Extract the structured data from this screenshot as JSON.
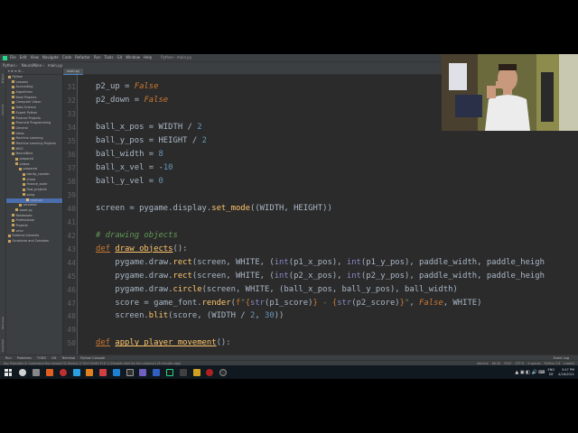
{
  "ide": {
    "window_title": "Python - main.py",
    "menu": [
      "File",
      "Edit",
      "View",
      "Navigate",
      "Code",
      "Refactor",
      "Run",
      "Tools",
      "Git",
      "Window",
      "Help"
    ],
    "nav": [
      "Python",
      "NeuralNine",
      "main.py"
    ],
    "tab": "main.py",
    "vertical_tabs": [
      "Project",
      "Commit",
      "Structure",
      "Favorites"
    ]
  },
  "project_tree": [
    {
      "label": "Python",
      "indent": 0
    },
    {
      "label": "Lessons",
      "indent": 1
    },
    {
      "label": "Accounting",
      "indent": 1
    },
    {
      "label": "Algorithms",
      "indent": 1
    },
    {
      "label": "Book Projects",
      "indent": 1
    },
    {
      "label": "Computer Vision",
      "indent": 1
    },
    {
      "label": "Data Science",
      "indent": 1
    },
    {
      "label": "Expert Python",
      "indent": 1
    },
    {
      "label": "Finance Projects",
      "indent": 1
    },
    {
      "label": "Financial Programming",
      "indent": 1
    },
    {
      "label": "General",
      "indent": 1
    },
    {
      "label": "Ideas",
      "indent": 1
    },
    {
      "label": "Machine Learning",
      "indent": 1
    },
    {
      "label": "Machine Learning Projects",
      "indent": 1
    },
    {
      "label": "MISC",
      "indent": 1
    },
    {
      "label": "NeuralNine",
      "indent": 1
    },
    {
      "label": "prepared",
      "indent": 2
    },
    {
      "label": "videos",
      "indent": 2
    },
    {
      "label": "prepared",
      "indent": 3
    },
    {
      "label": "bbcrip_counter",
      "indent": 4
    },
    {
      "label": "chess",
      "indent": 4
    },
    {
      "label": "finance_scale",
      "indent": 4
    },
    {
      "label": "flow_projects",
      "indent": 4
    },
    {
      "label": "pong",
      "indent": 4
    },
    {
      "label": "main.py",
      "indent": 5,
      "selected": true
    },
    {
      "label": "recorded",
      "indent": 3
    },
    {
      "label": "asset.py",
      "indent": 2
    },
    {
      "label": "Notebooks",
      "indent": 1
    },
    {
      "label": "Professional",
      "indent": 1
    },
    {
      "label": "Projects",
      "indent": 1
    },
    {
      "label": "venv",
      "indent": 1
    },
    {
      "label": "External Libraries",
      "indent": 0
    },
    {
      "label": "Scratches and Consoles",
      "indent": 0
    }
  ],
  "code_lines": [
    {
      "n": "31",
      "html": "p2_up = <span style=\"color:#cc7832;font-style:italic\">False</span>"
    },
    {
      "n": "32",
      "html": "p2_down = <span style=\"color:#cc7832;font-style:italic\">False</span>"
    },
    {
      "n": "33",
      "html": ""
    },
    {
      "n": "34",
      "html": "ball_x_pos = WIDTH / <span style=\"color:#6897bb\">2</span>"
    },
    {
      "n": "35",
      "html": "ball_y_pos = HEIGHT / <span style=\"color:#6897bb\">2</span>"
    },
    {
      "n": "36",
      "html": "ball_width = <span style=\"color:#6897bb\">8</span>"
    },
    {
      "n": "37",
      "html": "ball_x_vel = -<span style=\"color:#6897bb\">10</span>"
    },
    {
      "n": "38",
      "html": "ball_y_vel = <span style=\"color:#6897bb\">0</span>"
    },
    {
      "n": "39",
      "html": ""
    },
    {
      "n": "40",
      "html": "screen = pygame.display.<span style=\"color:#ffc66d\">set_mode</span>((WIDTH, HEIGHT))"
    },
    {
      "n": "41",
      "html": ""
    },
    {
      "n": "42",
      "html": "<span style=\"color:#629755;font-style:italic\"># drawing objects</span>"
    },
    {
      "n": "43",
      "html": "<span style=\"color:#cc7832;text-decoration:underline\">def</span> <span style=\"color:#ffc66d;text-decoration:underline\">draw_objects</span>():"
    },
    {
      "n": "44",
      "html": "    pygame.draw.<span style=\"color:#ffc66d\">rect</span>(screen, WHITE, (<span style=\"color:#8888c6\">int</span>(p1_x_pos), <span style=\"color:#8888c6\">int</span>(p1_y_pos), paddle_width, paddle_heigh"
    },
    {
      "n": "45",
      "html": "    pygame.draw.<span style=\"color:#ffc66d\">rect</span>(screen, WHITE, (<span style=\"color:#8888c6\">int</span>(p2_x_pos), <span style=\"color:#8888c6\">int</span>(p2_y_pos), paddle_width, paddle_heigh"
    },
    {
      "n": "46",
      "html": "    pygame.draw.<span style=\"color:#ffc66d\">circle</span>(screen, WHITE, (ball_x_pos, ball_y_pos), ball_width)"
    },
    {
      "n": "47",
      "html": "    score = game_font.<span style=\"color:#ffc66d\">render</span>(<span style=\"color:#cc7832\">f</span><span style=\"color:#6a8759\">\"</span><span style=\"color:#cc7832\">{</span><span style=\"color:#8888c6\">str</span>(p1_score)<span style=\"color:#cc7832\">}</span><span style=\"color:#6a8759\"> - </span><span style=\"color:#cc7832\">{</span><span style=\"color:#8888c6\">str</span>(p2_score)<span style=\"color:#cc7832\">}</span><span style=\"color:#6a8759\">\"</span>, <span style=\"color:#cc7832;font-style:italic\">False</span>, WHITE)"
    },
    {
      "n": "48",
      "html": "    screen.<span style=\"color:#ffc66d\">blit</span>(score, (WIDTH / <span style=\"color:#6897bb\">2</span>, <span style=\"color:#6897bb\">30</span>))"
    },
    {
      "n": "49",
      "html": ""
    },
    {
      "n": "50",
      "html": "<span style=\"color:#cc7832;text-decoration:underline\">def</span> <span style=\"color:#ffc66d;text-decoration:underline\">apply_player_movement</span>():"
    }
  ],
  "breadcrumb": "apply_ball_movement()   elif ball_x_pos + ball_vel < 0",
  "tool_windows": [
    "Run",
    "Problems",
    "TODO",
    "Git",
    "Terminal",
    "Python Console"
  ],
  "status": {
    "message": "Key Promoter X: Command Run missed 32 time(s) // 'Ctrl+Shift+F10' // (Disable alert for this shortcut) (9 minutes ago)",
    "right": [
      "tabnine",
      "86:30",
      "CRLF",
      "UTF-8",
      "4 spaces",
      "Python 3.8",
      "master"
    ],
    "event_log": "Event Log"
  },
  "clock": {
    "time": "3:47 PM",
    "date": "4/16/2021",
    "lang": "ENG",
    "region": "DE"
  }
}
